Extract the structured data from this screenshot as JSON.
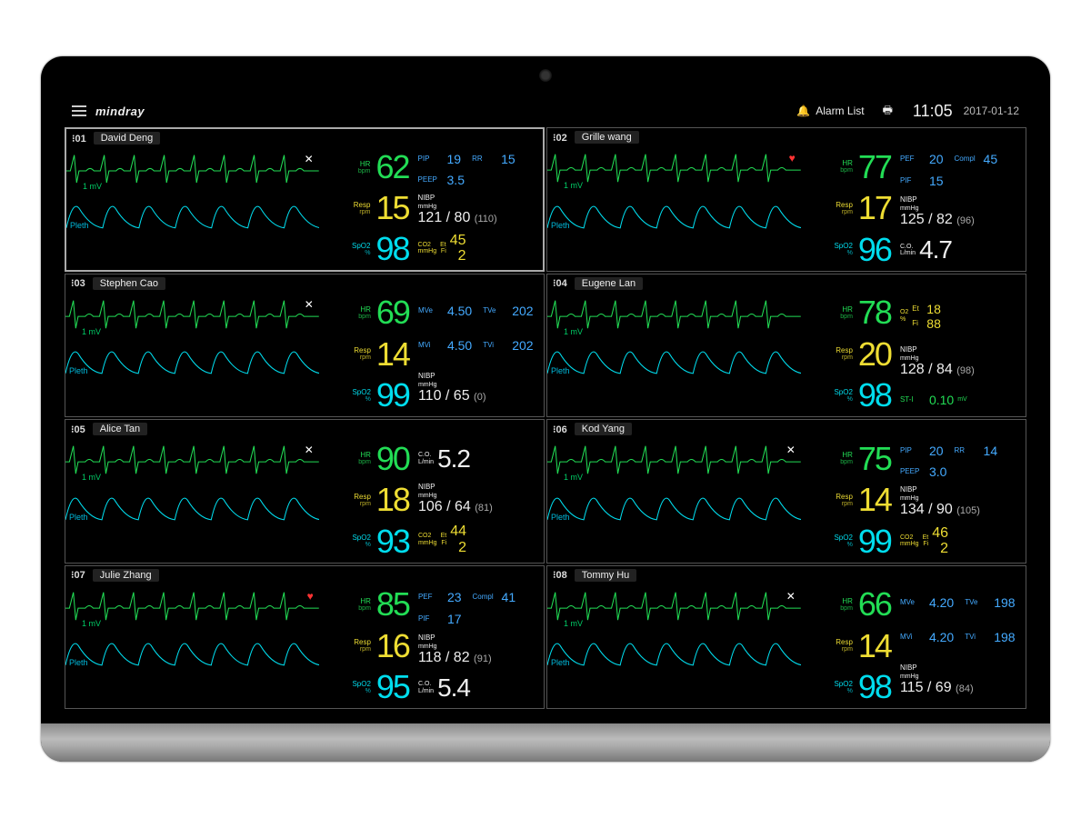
{
  "header": {
    "brand": "mindray",
    "alarm_list": "Alarm List",
    "time": "11:05",
    "date": "2017-01-12"
  },
  "labels": {
    "hr": "HR",
    "hr_unit": "bpm",
    "resp": "Resp",
    "resp_unit": "rpm",
    "spo2": "SpO2",
    "spo2_unit": "%",
    "pleth": "Pleth",
    "mv": "1 mV",
    "nibp": "NIBP",
    "nibp_unit": "mmHg",
    "co": "C.O.",
    "co_unit": "L/min",
    "co2": "CO2",
    "et": "Et",
    "fi": "Fi",
    "pip": "PIP",
    "peep": "PEEP",
    "rr": "RR",
    "pef": "PEF",
    "pif": "PIF",
    "compl": "Compl",
    "mve": "MVe",
    "mvi": "MVi",
    "tve": "TVe",
    "tvi": "TVi",
    "o2": "O2",
    "st": "ST-I"
  },
  "cells": [
    {
      "bed": "01",
      "name": "David Deng",
      "primary": true,
      "alarm_off": true,
      "hr": "62",
      "resp": "15",
      "spo2": "98",
      "extra": [
        {
          "type": "pair",
          "l1": "PIP",
          "v1": "19",
          "l2": "RR",
          "v2": "15",
          "color": "c-blue"
        },
        {
          "type": "single",
          "l": "PEEP",
          "v": "3.5",
          "color": "c-blue"
        },
        {
          "type": "nibp",
          "sys": "121",
          "dia": "80",
          "mean": "(110)"
        },
        {
          "type": "co2",
          "et": "45",
          "fi": "2"
        }
      ]
    },
    {
      "bed": "02",
      "name": "Grille wang",
      "heart": true,
      "hr": "77",
      "resp": "17",
      "spo2": "96",
      "extra": [
        {
          "type": "pair",
          "l1": "PEF",
          "v1": "20",
          "l2": "Compl",
          "v2": "45",
          "color": "c-blue"
        },
        {
          "type": "single",
          "l": "PIF",
          "v": "15",
          "color": "c-blue"
        },
        {
          "type": "nibp",
          "sys": "125",
          "dia": "82",
          "mean": "(96)"
        },
        {
          "type": "big",
          "l": "C.O.",
          "u": "L/min",
          "v": "4.7",
          "color": "c-white"
        }
      ]
    },
    {
      "bed": "03",
      "name": "Stephen Cao",
      "alarm_off": true,
      "hr": "69",
      "resp": "14",
      "spo2": "99",
      "extra": [
        {
          "type": "pair",
          "l1": "MVe",
          "v1": "4.50",
          "l2": "TVe",
          "v2": "202",
          "color": "c-blue"
        },
        {
          "type": "pair",
          "l1": "MVi",
          "v1": "4.50",
          "l2": "TVi",
          "v2": "202",
          "color": "c-blue"
        },
        {
          "type": "nibp",
          "sys": "110",
          "dia": "65",
          "mean": "(0)"
        }
      ]
    },
    {
      "bed": "04",
      "name": "Eugene Lan",
      "hr": "78",
      "resp": "20",
      "spo2": "98",
      "extra": [
        {
          "type": "stack",
          "l": "O2",
          "rows": [
            [
              "Et",
              "18"
            ],
            [
              "Fi",
              "88"
            ]
          ],
          "color": "c-yellow"
        },
        {
          "type": "nibp",
          "sys": "128",
          "dia": "84",
          "mean": "(98)"
        },
        {
          "type": "single",
          "l": "ST-I",
          "v": "0.10",
          "color": "c-green",
          "u": "mV"
        }
      ]
    },
    {
      "bed": "05",
      "name": "Alice Tan",
      "alarm_off": true,
      "hr": "90",
      "resp": "18",
      "spo2": "93",
      "extra": [
        {
          "type": "big",
          "l": "C.O.",
          "u": "L/min",
          "v": "5.2",
          "color": "c-white"
        },
        {
          "type": "nibp",
          "sys": "106",
          "dia": "64",
          "mean": "(81)"
        },
        {
          "type": "co2",
          "et": "44",
          "fi": "2"
        }
      ]
    },
    {
      "bed": "06",
      "name": "Kod Yang",
      "alarm_off": true,
      "hr": "75",
      "resp": "14",
      "spo2": "99",
      "extra": [
        {
          "type": "pair",
          "l1": "PIP",
          "v1": "20",
          "l2": "RR",
          "v2": "14",
          "color": "c-blue"
        },
        {
          "type": "single",
          "l": "PEEP",
          "v": "3.0",
          "color": "c-blue"
        },
        {
          "type": "nibp",
          "sys": "134",
          "dia": "90",
          "mean": "(105)"
        },
        {
          "type": "co2",
          "et": "46",
          "fi": "2"
        }
      ]
    },
    {
      "bed": "07",
      "name": "Julie Zhang",
      "heart": true,
      "hr": "85",
      "resp": "16",
      "spo2": "95",
      "extra": [
        {
          "type": "pair",
          "l1": "PEF",
          "v1": "23",
          "l2": "Compl",
          "v2": "41",
          "color": "c-blue"
        },
        {
          "type": "single",
          "l": "PIF",
          "v": "17",
          "color": "c-blue"
        },
        {
          "type": "nibp",
          "sys": "118",
          "dia": "82",
          "mean": "(91)"
        },
        {
          "type": "big",
          "l": "C.O.",
          "u": "L/min",
          "v": "5.4",
          "color": "c-white"
        }
      ]
    },
    {
      "bed": "08",
      "name": "Tommy Hu",
      "alarm_off": true,
      "hr": "66",
      "resp": "14",
      "spo2": "98",
      "extra": [
        {
          "type": "pair",
          "l1": "MVe",
          "v1": "4.20",
          "l2": "TVe",
          "v2": "198",
          "color": "c-blue"
        },
        {
          "type": "pair",
          "l1": "MVi",
          "v1": "4.20",
          "l2": "TVi",
          "v2": "198",
          "color": "c-blue"
        },
        {
          "type": "nibp",
          "sys": "115",
          "dia": "69",
          "mean": "(84)"
        }
      ]
    }
  ]
}
